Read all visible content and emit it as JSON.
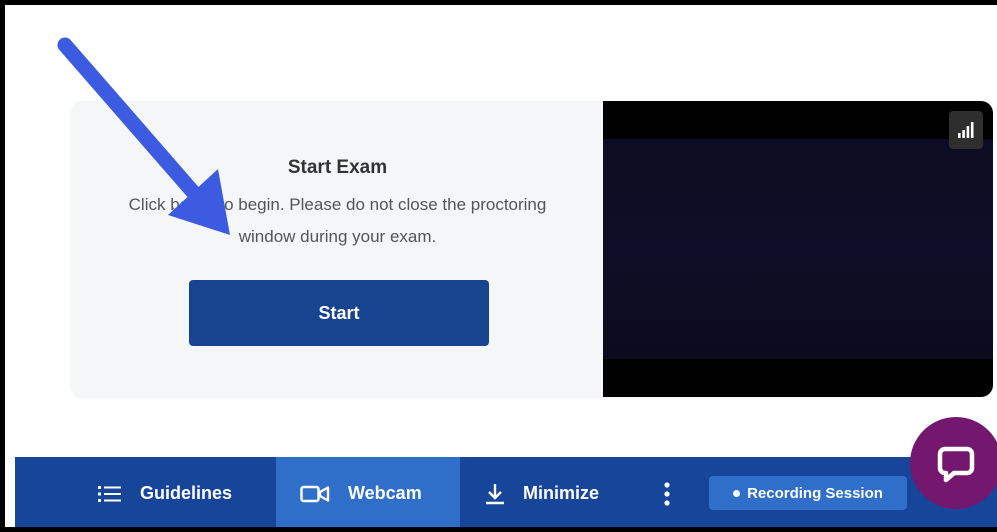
{
  "exam": {
    "title": "Start Exam",
    "description": "Click below to begin. Please do not close the proctoring window during your exam.",
    "start_label": "Start"
  },
  "toolbar": {
    "guidelines_label": "Guidelines",
    "webcam_label": "Webcam",
    "minimize_label": "Minimize",
    "recording_label": "Recording Session"
  },
  "icons": {
    "guidelines": "list-icon",
    "webcam": "video-camera-icon",
    "minimize": "download-arrow-icon",
    "more": "vertical-ellipsis-icon",
    "signal": "signal-bars-icon",
    "chat": "chat-bubble-icon",
    "annotation": "arrow-annotation"
  },
  "colors": {
    "primary": "#17448f",
    "toolbar": "#17459a",
    "toolbar_active": "#2f6fc9",
    "chat": "#74176f",
    "annotation_arrow": "#3d5be0"
  }
}
